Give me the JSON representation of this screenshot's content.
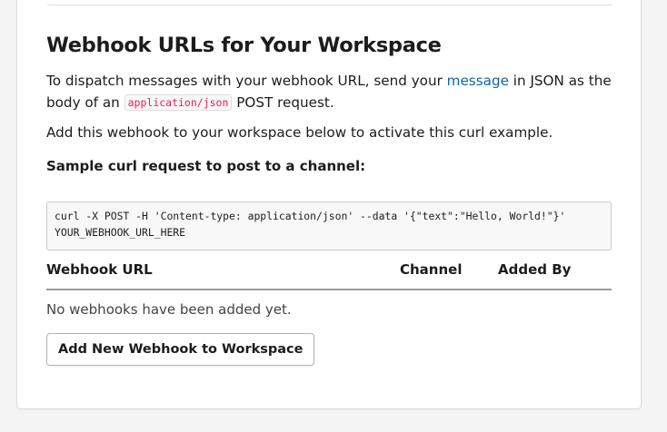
{
  "section": {
    "title": "Webhook URLs for Your Workspace",
    "intro_before_link": "To dispatch messages with your webhook URL, send your ",
    "intro_link": "message",
    "intro_after_link": " in JSON as the body of an ",
    "intro_code": "application/json",
    "intro_end": " POST request.",
    "note": "Add this webhook to your workspace below to activate this curl example.",
    "sample_label": "Sample curl request to post to a channel:",
    "sample_code": "curl -X POST -H 'Content-type: application/json' --data '{\"text\":\"Hello, World!\"}' YOUR_WEBHOOK_URL_HERE"
  },
  "table": {
    "headers": [
      "Webhook URL",
      "Channel",
      "Added By"
    ],
    "empty_message": "No webhooks have been added yet."
  },
  "actions": {
    "add_webhook_label": "Add New Webhook to Workspace"
  },
  "colors": {
    "link": "#1264a3",
    "code_text": "#e01e5a",
    "text": "#1d1c1d",
    "background": "#f4f4f4"
  }
}
